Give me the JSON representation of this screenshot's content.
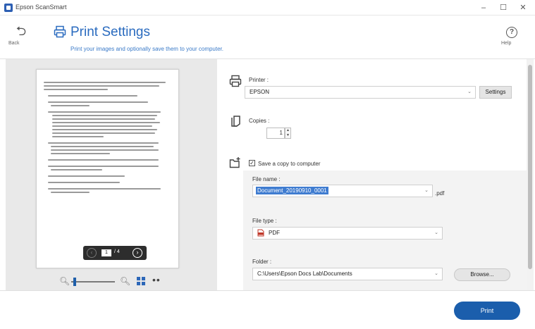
{
  "window": {
    "title": "Epson ScanSmart",
    "minimize": "–",
    "maximize": "☐",
    "close": "✕"
  },
  "header": {
    "back_label": "Back",
    "title": "Print Settings",
    "subtitle": "Print your images and optionally save them to your computer.",
    "help_label": "Help"
  },
  "preview": {
    "current_page": "1",
    "total_pages": "/ 4",
    "zoom_level": 0.05
  },
  "printer": {
    "label": "Printer :",
    "value": "EPSON",
    "settings_button": "Settings"
  },
  "copies": {
    "label": "Copies :",
    "value": "1"
  },
  "save_copy": {
    "checkbox_label": "Save a copy to computer",
    "checked": true,
    "file_name_label": "File name :",
    "file_name_value": "Document_20190910_0001",
    "extension": ".pdf",
    "file_type_label": "File type :",
    "file_type_value": "PDF",
    "folder_label": "Folder :",
    "folder_value": "C:\\Users\\Epson Docs Lab\\Documents",
    "browse_button": "Browse..."
  },
  "actions": {
    "print_button": "Print"
  },
  "colors": {
    "accent": "#2a6bbf",
    "print_button": "#1b5eac"
  }
}
